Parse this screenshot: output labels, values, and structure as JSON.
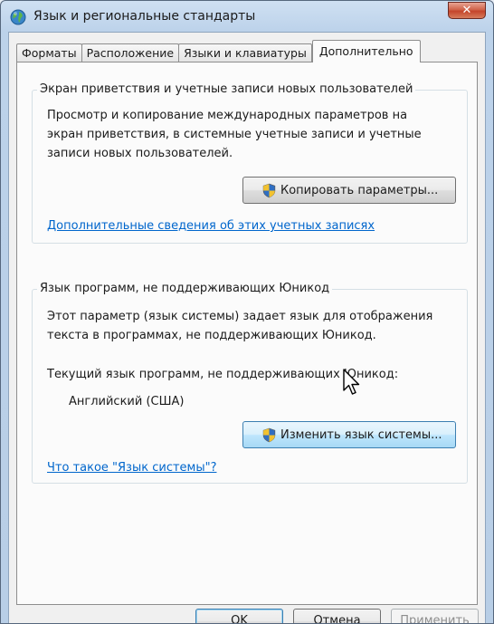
{
  "window": {
    "title": "Язык и региональные стандарты",
    "close_label": "✕"
  },
  "tabs": [
    {
      "label": "Форматы"
    },
    {
      "label": "Расположение"
    },
    {
      "label": "Языки и клавиатуры"
    },
    {
      "label": "Дополнительно",
      "active": true
    }
  ],
  "welcome_group": {
    "title": "Экран приветствия и учетные записи новых пользователей",
    "description": "Просмотр и копирование международных параметров на экран приветствия, в системные учетные записи и учетные записи новых пользователей.",
    "copy_button": "Копировать параметры...",
    "link": "Дополнительные сведения об этих учетных записях"
  },
  "nonunicode_group": {
    "title": "Язык программ, не поддерживающих Юникод",
    "description": "Этот параметр (язык системы) задает язык для отображения текста в программах, не поддерживающих Юникод.",
    "current_label": "Текущий язык программ, не поддерживающих Юникод:",
    "current_value": "Английский (США)",
    "change_button": "Изменить язык системы...",
    "link": "Что такое \"Язык системы\"?"
  },
  "footer": {
    "ok": "OK",
    "cancel": "Отмена",
    "apply": "Применить"
  },
  "icons": {
    "title_icon": "globe-icon",
    "shield_icon": "uac-shield-icon",
    "cursor": "mouse-pointer-icon"
  }
}
